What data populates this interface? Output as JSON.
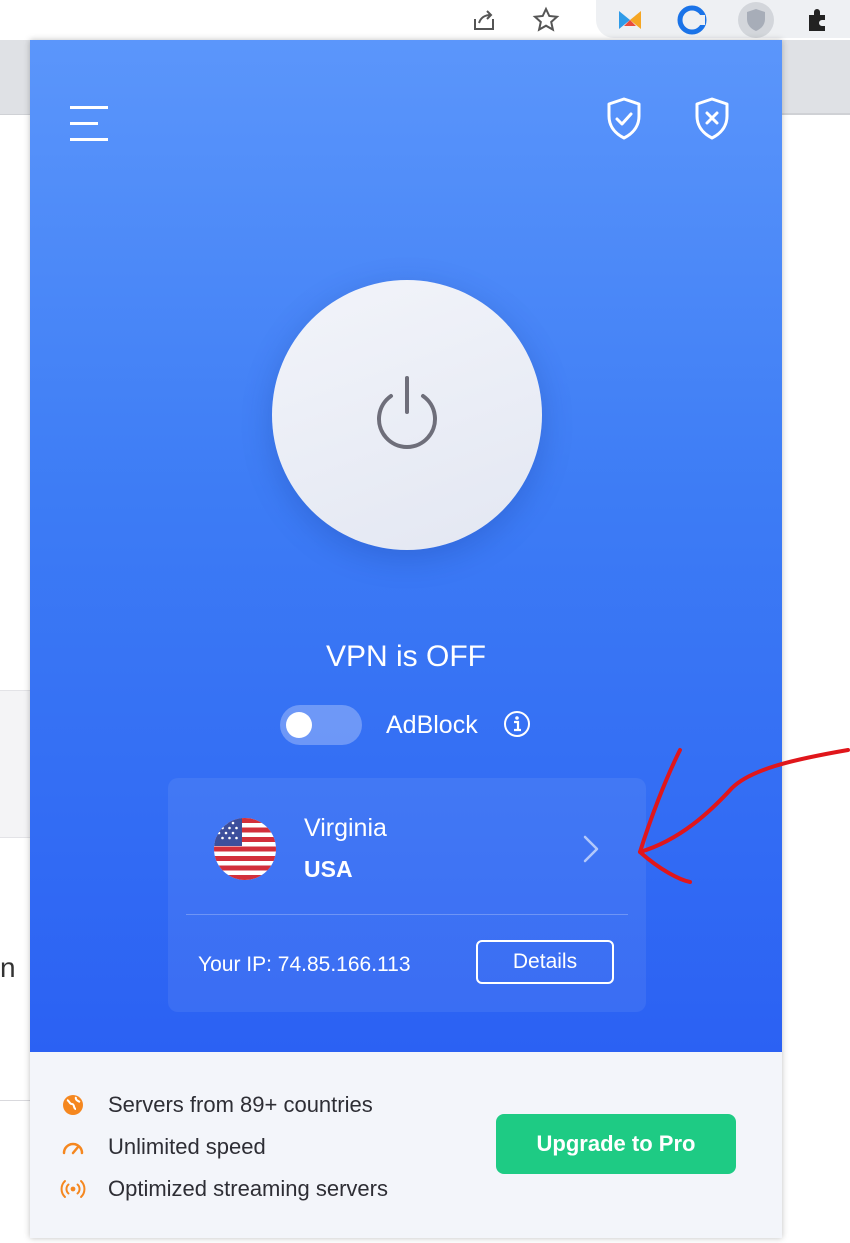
{
  "popup": {
    "status": "VPN is OFF",
    "adblock": {
      "label": "AdBlock",
      "enabled": false
    },
    "location": {
      "city": "Virginia",
      "country": "USA"
    },
    "ip": {
      "label": "Your IP: 74.85.166.113",
      "details_label": "Details"
    },
    "features": [
      {
        "icon": "globe-icon",
        "text": "Servers from 89+ countries"
      },
      {
        "icon": "speedometer-icon",
        "text": "Unlimited speed"
      },
      {
        "icon": "broadcast-icon",
        "text": "Optimized streaming servers"
      }
    ],
    "upgrade_label": "Upgrade to Pro"
  },
  "background_page": {
    "snippet": "n"
  },
  "colors": {
    "hero_top": "#5b96fb",
    "hero_bottom": "#2b61f3",
    "upgrade_green": "#1ecb84",
    "feature_orange": "#f5871f",
    "annotation_red": "#e0161b"
  }
}
